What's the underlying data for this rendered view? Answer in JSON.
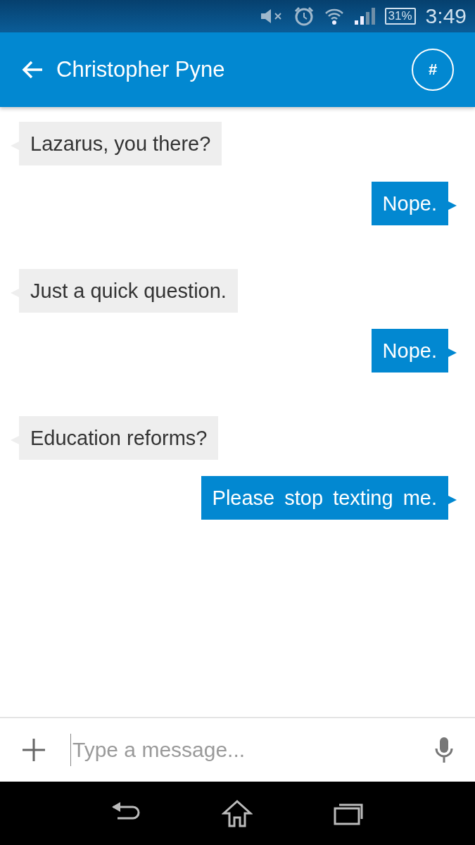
{
  "status_bar": {
    "battery": "31%",
    "time": "3:49"
  },
  "header": {
    "title": "Christopher Pyne",
    "action": "#"
  },
  "messages": [
    {
      "kind": "in",
      "text": "Lazarus, you there?"
    },
    {
      "kind": "out",
      "text": "Nope."
    },
    {
      "kind": "in",
      "text": "Just a quick question."
    },
    {
      "kind": "out",
      "text": "Nope."
    },
    {
      "kind": "in",
      "text": "Education reforms?"
    },
    {
      "kind": "out",
      "text": "Please stop texting me."
    }
  ],
  "composer": {
    "placeholder": "Type a message..."
  }
}
